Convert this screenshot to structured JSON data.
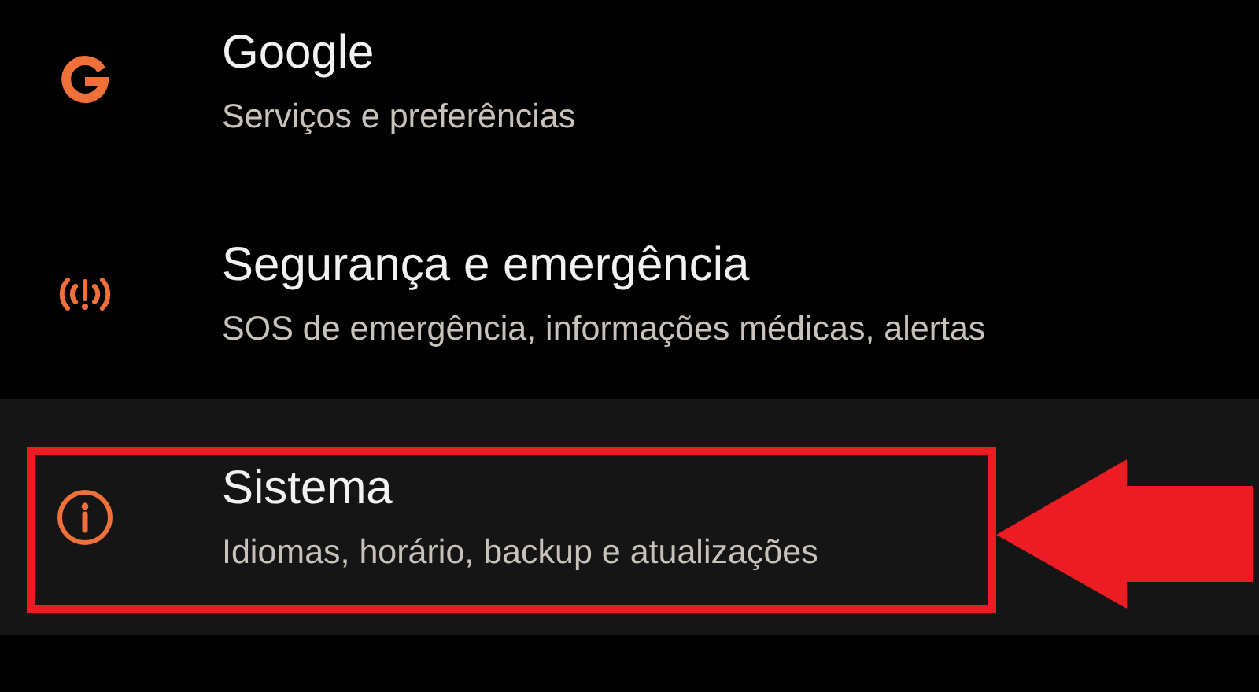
{
  "settings_items": [
    {
      "kind": "google",
      "title": "Google",
      "subtitle": "Serviços e preferências",
      "selected": false,
      "annotated": false
    },
    {
      "kind": "emergency",
      "title": "Segurança e emergência",
      "subtitle": "SOS de emergência, informações médicas, alertas",
      "selected": false,
      "annotated": false
    },
    {
      "kind": "info",
      "title": "Sistema",
      "subtitle": "Idiomas, horário, backup e atualizações",
      "selected": true,
      "annotated": true
    }
  ]
}
